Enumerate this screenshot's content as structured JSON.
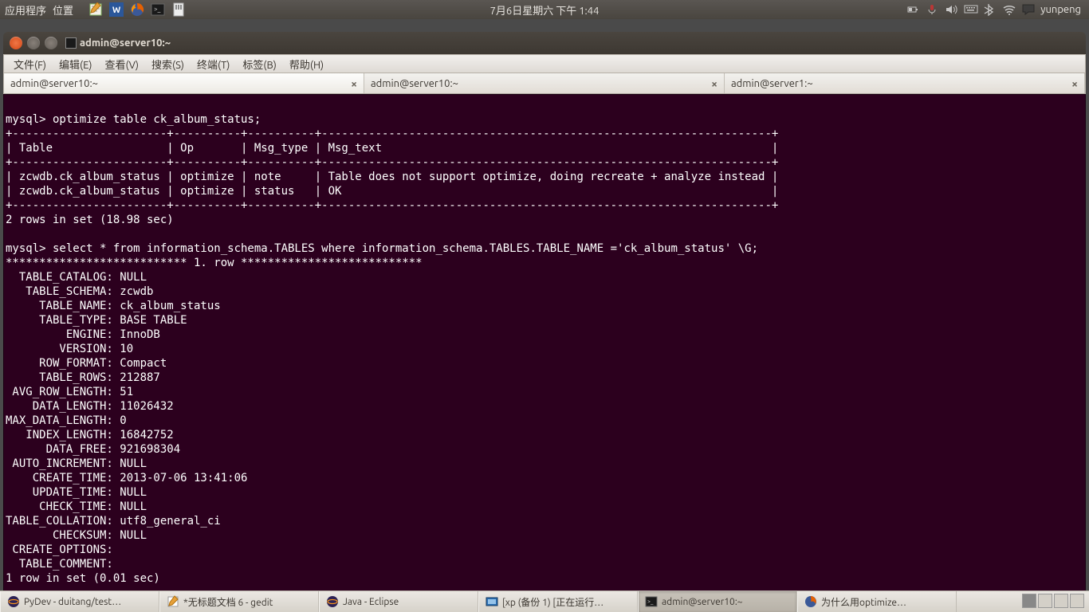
{
  "top_panel": {
    "apps_label": "应用程序",
    "places_label": "位置",
    "datetime": "7月6日星期六 下午  1:44",
    "user": "yunpeng"
  },
  "window": {
    "title": "admin@server10:~"
  },
  "menubar": {
    "items": [
      "文件(F)",
      "编辑(E)",
      "查看(V)",
      "搜索(S)",
      "终端(T)",
      "标签(B)",
      "帮助(H)"
    ]
  },
  "tabs": [
    {
      "label": "admin@server10:~",
      "active": true
    },
    {
      "label": "admin@server10:~",
      "active": false
    },
    {
      "label": "admin@server1:~",
      "active": false
    }
  ],
  "terminal_text": "\nmysql> optimize table ck_album_status;\n+-----------------------+----------+----------+-------------------------------------------------------------------+\n| Table                 | Op       | Msg_type | Msg_text                                                          |\n+-----------------------+----------+----------+-------------------------------------------------------------------+\n| zcwdb.ck_album_status | optimize | note     | Table does not support optimize, doing recreate + analyze instead |\n| zcwdb.ck_album_status | optimize | status   | OK                                                                |\n+-----------------------+----------+----------+-------------------------------------------------------------------+\n2 rows in set (18.98 sec)\n\nmysql> select * from information_schema.TABLES where information_schema.TABLES.TABLE_NAME ='ck_album_status' \\G;\n*************************** 1. row ***************************\n  TABLE_CATALOG: NULL\n   TABLE_SCHEMA: zcwdb\n     TABLE_NAME: ck_album_status\n     TABLE_TYPE: BASE TABLE\n         ENGINE: InnoDB\n        VERSION: 10\n     ROW_FORMAT: Compact\n     TABLE_ROWS: 212887\n AVG_ROW_LENGTH: 51\n    DATA_LENGTH: 11026432\nMAX_DATA_LENGTH: 0\n   INDEX_LENGTH: 16842752\n      DATA_FREE: 921698304\n AUTO_INCREMENT: NULL\n    CREATE_TIME: 2013-07-06 13:41:06\n    UPDATE_TIME: NULL\n     CHECK_TIME: NULL\nTABLE_COLLATION: utf8_general_ci\n       CHECKSUM: NULL\n CREATE_OPTIONS: \n  TABLE_COMMENT: \n1 row in set (0.01 sec)",
  "taskbar": [
    {
      "label": "PyDev - duitang/test…",
      "icon": "eclipse"
    },
    {
      "label": "*无标题文档 6 - gedit",
      "icon": "gedit"
    },
    {
      "label": "Java - Eclipse",
      "icon": "eclipse"
    },
    {
      "label": "[xp (备份 1) [正在运行…",
      "icon": "vbox"
    },
    {
      "label": "admin@server10:~",
      "icon": "terminal",
      "active": true
    },
    {
      "label": "为什么用optimize…",
      "icon": "firefox"
    }
  ]
}
